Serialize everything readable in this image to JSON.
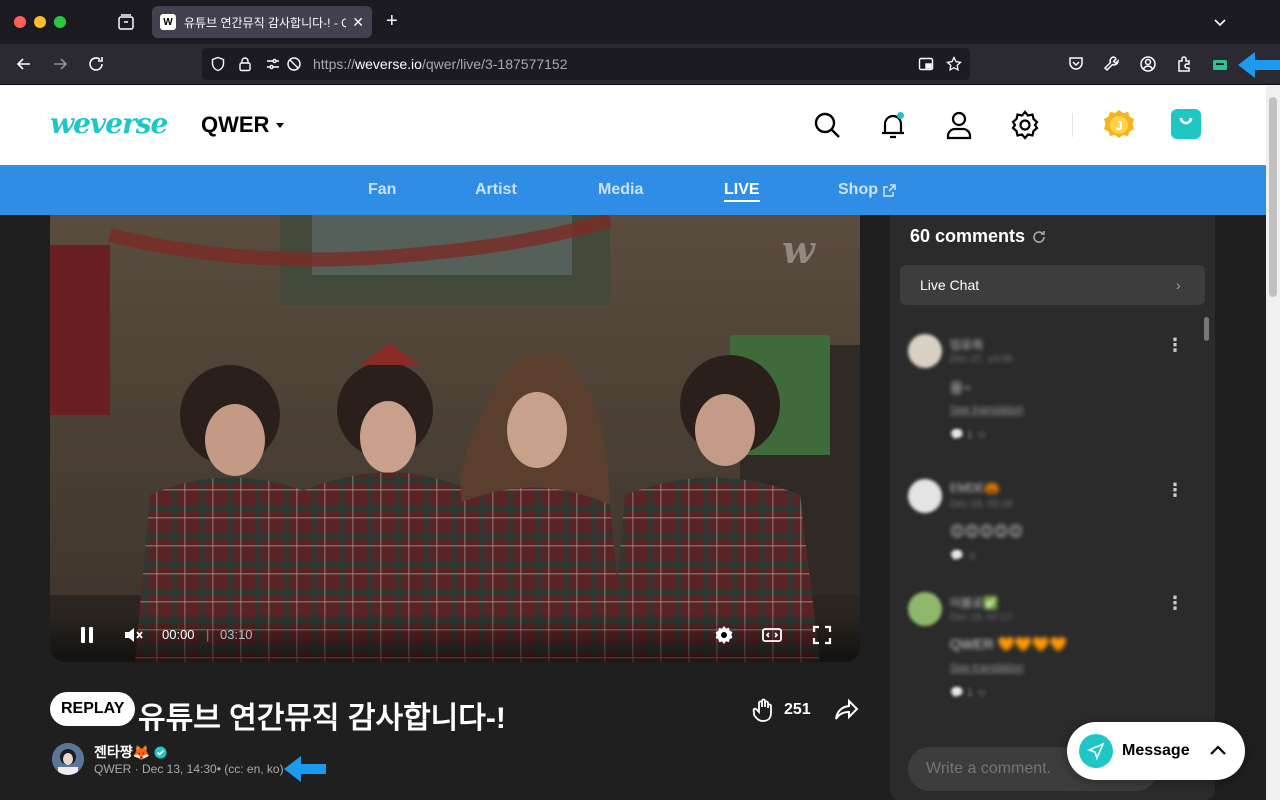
{
  "browser": {
    "tab_title": "유튜브 연간뮤직 감사합니다-! - QWER",
    "tab_favicon": "W",
    "url_scheme": "https://",
    "url_host": "weverse.io",
    "url_path": "/qwer/live/3-187577152",
    "extension_badge": "2"
  },
  "header": {
    "logo": "weverse",
    "artist": "QWER",
    "coin_letter": "J",
    "colors": {
      "accent": "#1fc6c6",
      "nav_blue": "#2f8de6"
    }
  },
  "nav": {
    "items": [
      {
        "label": "Fan"
      },
      {
        "label": "Artist"
      },
      {
        "label": "Media"
      },
      {
        "label": "LIVE"
      },
      {
        "label": "Shop"
      }
    ],
    "active": "LIVE"
  },
  "video": {
    "watermark": "w",
    "current_time": "00:00",
    "duration": "03:10"
  },
  "info": {
    "badge": "REPLAY",
    "title": "유튜브 연간뮤직 감사합니다-!",
    "likes": "251",
    "host_name": "젠타쨩🦊",
    "host_meta": "QWER · Dec 13, 14:30• (cc: en, ko)"
  },
  "comments": {
    "header": "60 comments",
    "live_chat": "Live Chat",
    "items": [
      {
        "name": "임유희",
        "date": "Dec 27, 14:08",
        "body": "응~",
        "translation": "See translation",
        "avatar_color": "#d9d1c4"
      },
      {
        "name": "EMDE🎃",
        "date": "Dec 18, 03:18",
        "body": "😊😊😊😊😊",
        "translation": "",
        "avatar_color": "#e4e4e4"
      },
      {
        "name": "이봄로✅",
        "date": "Dec 15, 07:17",
        "body": "QWER 🧡🧡🧡🧡",
        "translation": "See translation",
        "avatar_color": "#8fb86b"
      }
    ],
    "write_placeholder": "Write a comment.",
    "message_button": "Message"
  }
}
